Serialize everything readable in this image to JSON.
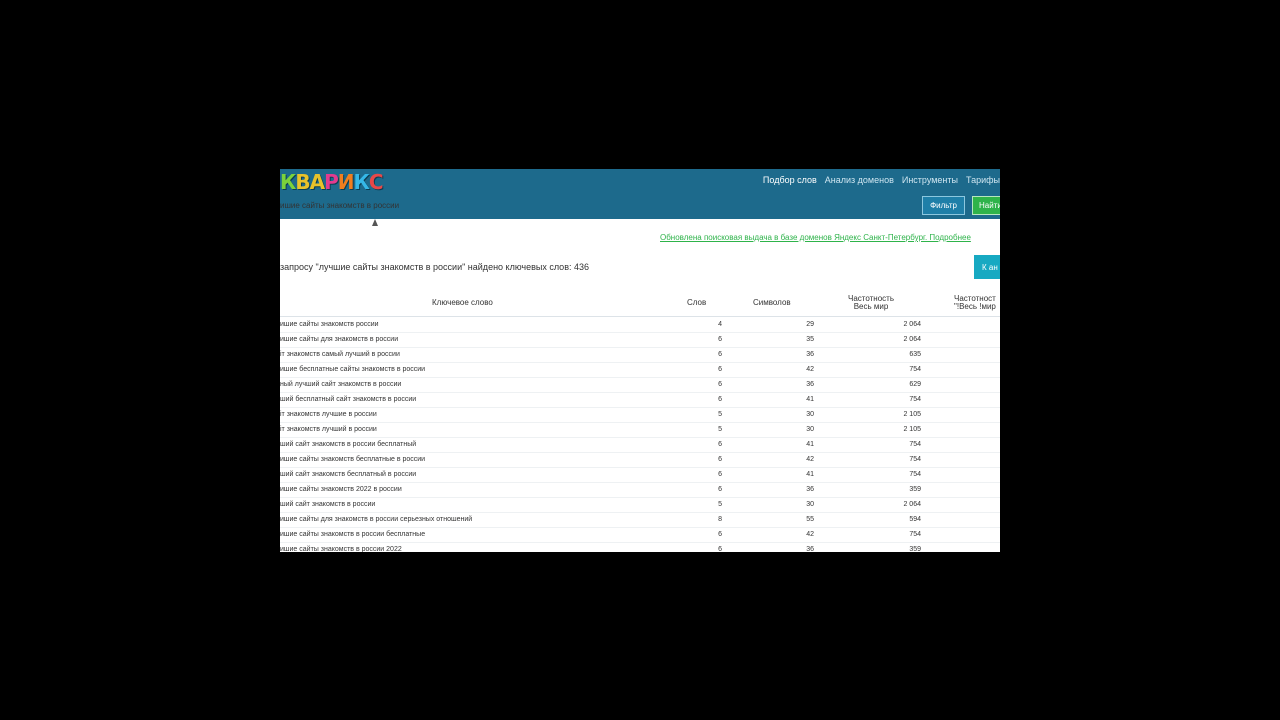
{
  "header": {
    "logo": [
      "К",
      "В",
      "А",
      "Р",
      "И",
      "К",
      "С"
    ],
    "logo_colors": [
      "#7ad23c",
      "#e8c22a",
      "#e8c22a",
      "#e23b8f",
      "#f07e1f",
      "#35b8e8",
      "#e84848"
    ],
    "nav": [
      {
        "label": "Подбор слов",
        "active": true
      },
      {
        "label": "Анализ доменов",
        "active": false
      },
      {
        "label": "Инструменты",
        "active": false
      },
      {
        "label": "Тарифы",
        "active": false
      }
    ],
    "search_value": "ишие сайты знакомств в россии",
    "filter_label": "Фильтр",
    "find_label": "Найти"
  },
  "notice": "Обновлена поисковая выдача в базе доменов Яндекс Санкт-Петербург. Подробнее",
  "result_text": "запросу \"лучшие сайты знакомств в россии\" найдено ключевых слов: 436",
  "export_label": "К ан",
  "table": {
    "headers": {
      "keyword": "Ключевое слово",
      "words": "Слов",
      "chars": "Символов",
      "freq1_line1": "Частотность",
      "freq1_line2": "Весь мир",
      "freq2_line1": "Частотност",
      "freq2_line2": "\"!Весь !мир"
    },
    "rows": [
      {
        "kw": "ишие сайты знакомств россии",
        "words": "4",
        "chars": "29",
        "freq": "2 064"
      },
      {
        "kw": "ишие сайты для знакомств в россии",
        "words": "6",
        "chars": "35",
        "freq": "2 064"
      },
      {
        "kw": "іт знакомств самый лучший в россии",
        "words": "6",
        "chars": "36",
        "freq": "635"
      },
      {
        "kw": "ишие бесплатные сайты знакомств в россии",
        "words": "6",
        "chars": "42",
        "freq": "754"
      },
      {
        "kw": "ный лучший сайт знакомств в россии",
        "words": "6",
        "chars": "36",
        "freq": "629"
      },
      {
        "kw": "ший бесплатный сайт знакомств в россии",
        "words": "6",
        "chars": "41",
        "freq": "754"
      },
      {
        "kw": "іт знакомств лучшие в россии",
        "words": "5",
        "chars": "30",
        "freq": "2 105"
      },
      {
        "kw": "іт знакомств лучший в россии",
        "words": "5",
        "chars": "30",
        "freq": "2 105"
      },
      {
        "kw": "ший сайт знакомств в россии бесплатный",
        "words": "6",
        "chars": "41",
        "freq": "754"
      },
      {
        "kw": "ишие сайты знакомств бесплатные в россии",
        "words": "6",
        "chars": "42",
        "freq": "754"
      },
      {
        "kw": "ший сайт знакомств бесплатный в россии",
        "words": "6",
        "chars": "41",
        "freq": "754"
      },
      {
        "kw": "ишие сайты знакомств 2022 в россии",
        "words": "6",
        "chars": "36",
        "freq": "359"
      },
      {
        "kw": "ший сайт знакомств в россии",
        "words": "5",
        "chars": "30",
        "freq": "2 064"
      },
      {
        "kw": "ишие сайты для знакомств в россии серьезных отношений",
        "words": "8",
        "chars": "55",
        "freq": "594"
      },
      {
        "kw": "ишие сайты знакомств в россии бесплатные",
        "words": "6",
        "chars": "42",
        "freq": "754"
      },
      {
        "kw": "ишие сайты знакомств в россии 2022",
        "words": "6",
        "chars": "36",
        "freq": "359"
      }
    ]
  }
}
